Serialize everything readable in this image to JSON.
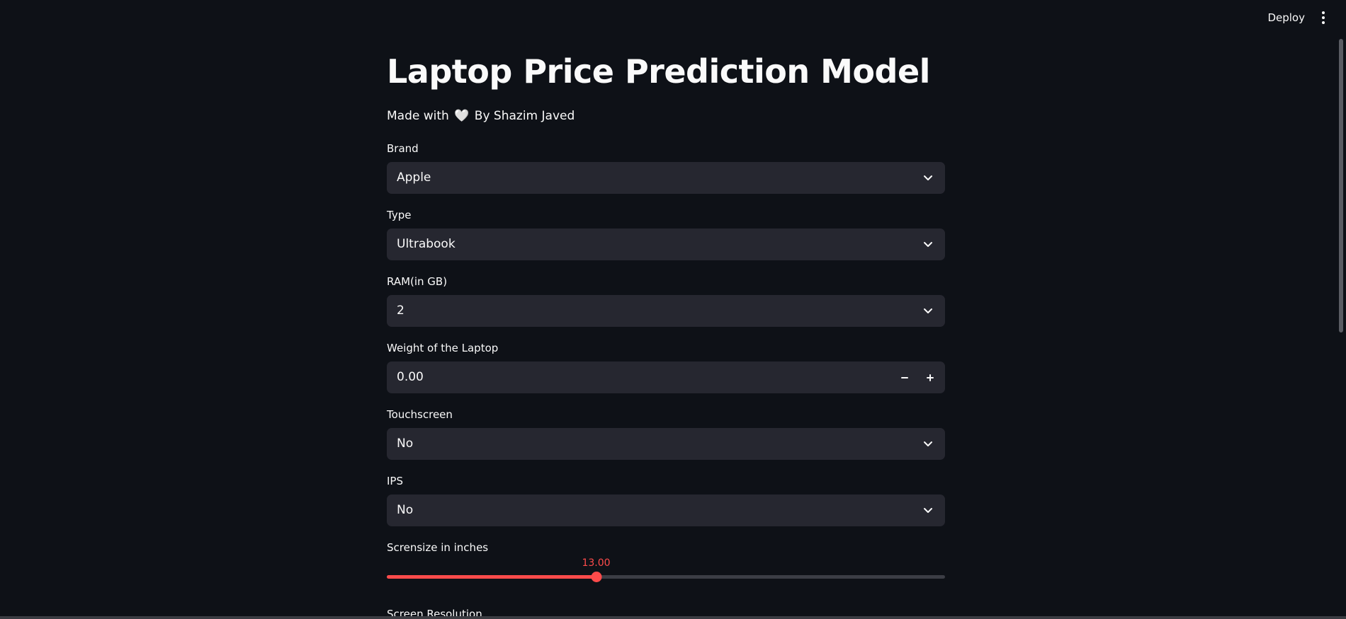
{
  "header": {
    "deploy_label": "Deploy",
    "menu_icon": "more-vertical-icon"
  },
  "main": {
    "title": "Laptop Price Prediction Model",
    "byline_prefix": "Made with",
    "byline_heart": "🤍",
    "byline_suffix": "By Shazim Javed"
  },
  "fields": {
    "brand": {
      "label": "Brand",
      "value": "Apple"
    },
    "type": {
      "label": "Type",
      "value": "Ultrabook"
    },
    "ram": {
      "label": "RAM(in GB)",
      "value": "2"
    },
    "weight": {
      "label": "Weight of the Laptop",
      "value": "0.00",
      "minus": "−",
      "plus": "+"
    },
    "touchscreen": {
      "label": "Touchscreen",
      "value": "No"
    },
    "ips": {
      "label": "IPS",
      "value": "No"
    },
    "screensize": {
      "label": "Scrensize in inches",
      "value_text": "13.00",
      "fraction": 0.375
    },
    "resolution": {
      "label": "Screen Resolution"
    }
  },
  "colors": {
    "background": "#0e1117",
    "input_bg": "#262730",
    "accent": "#ff4b4b",
    "text": "#fafafa"
  }
}
